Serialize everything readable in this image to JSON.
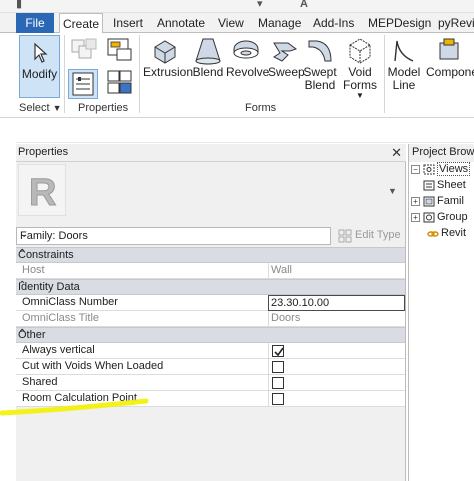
{
  "tabs": {
    "file": "File",
    "items": [
      "Create",
      "Insert",
      "Annotate",
      "View",
      "Manage",
      "Add-Ins",
      "MEPDesign",
      "pyRevit"
    ],
    "active": "Create"
  },
  "ribbon": {
    "select_panel": {
      "modify_label": "Modify",
      "panel_label": "Select"
    },
    "properties_panel": {
      "panel_label": "Properties"
    },
    "forms_panel": {
      "panel_label": "Forms",
      "buttons": [
        {
          "label": "Extrusion"
        },
        {
          "label": "Blend"
        },
        {
          "label": "Revolve"
        },
        {
          "label": "Sweep"
        },
        {
          "label": "Swept\nBlend"
        },
        {
          "label": "Void\nForms"
        }
      ]
    },
    "model_panel": {
      "buttons": [
        {
          "label": "Model\nLine"
        },
        {
          "label": "Compone"
        }
      ]
    }
  },
  "properties": {
    "title": "Properties",
    "close_glyph": "✕",
    "family_selector": "Family: Doors",
    "edit_type": "Edit Type",
    "groups": [
      {
        "name": "Constraints",
        "rows": [
          {
            "label": "Host",
            "value": "Wall",
            "editable": false
          }
        ]
      },
      {
        "name": "Identity Data",
        "rows": [
          {
            "label": "OmniClass Number",
            "value": "23.30.10.00",
            "editable": true
          },
          {
            "label": "OmniClass Title",
            "value": "Doors",
            "editable": false
          }
        ]
      },
      {
        "name": "Other",
        "rows": [
          {
            "label": "Always vertical",
            "checked": true
          },
          {
            "label": "Cut with Voids When Loaded",
            "checked": false
          },
          {
            "label": "Shared",
            "checked": false
          },
          {
            "label": "Room Calculation Point",
            "checked": false
          }
        ]
      }
    ]
  },
  "project_browser": {
    "title": "Project Brow...",
    "items": [
      "Views",
      "Sheet",
      "Famil",
      "Group",
      "Revit"
    ]
  },
  "colors": {
    "file_tab": "#2a68b5",
    "group_header": "#dadce3",
    "highlight": "#f2f200"
  }
}
